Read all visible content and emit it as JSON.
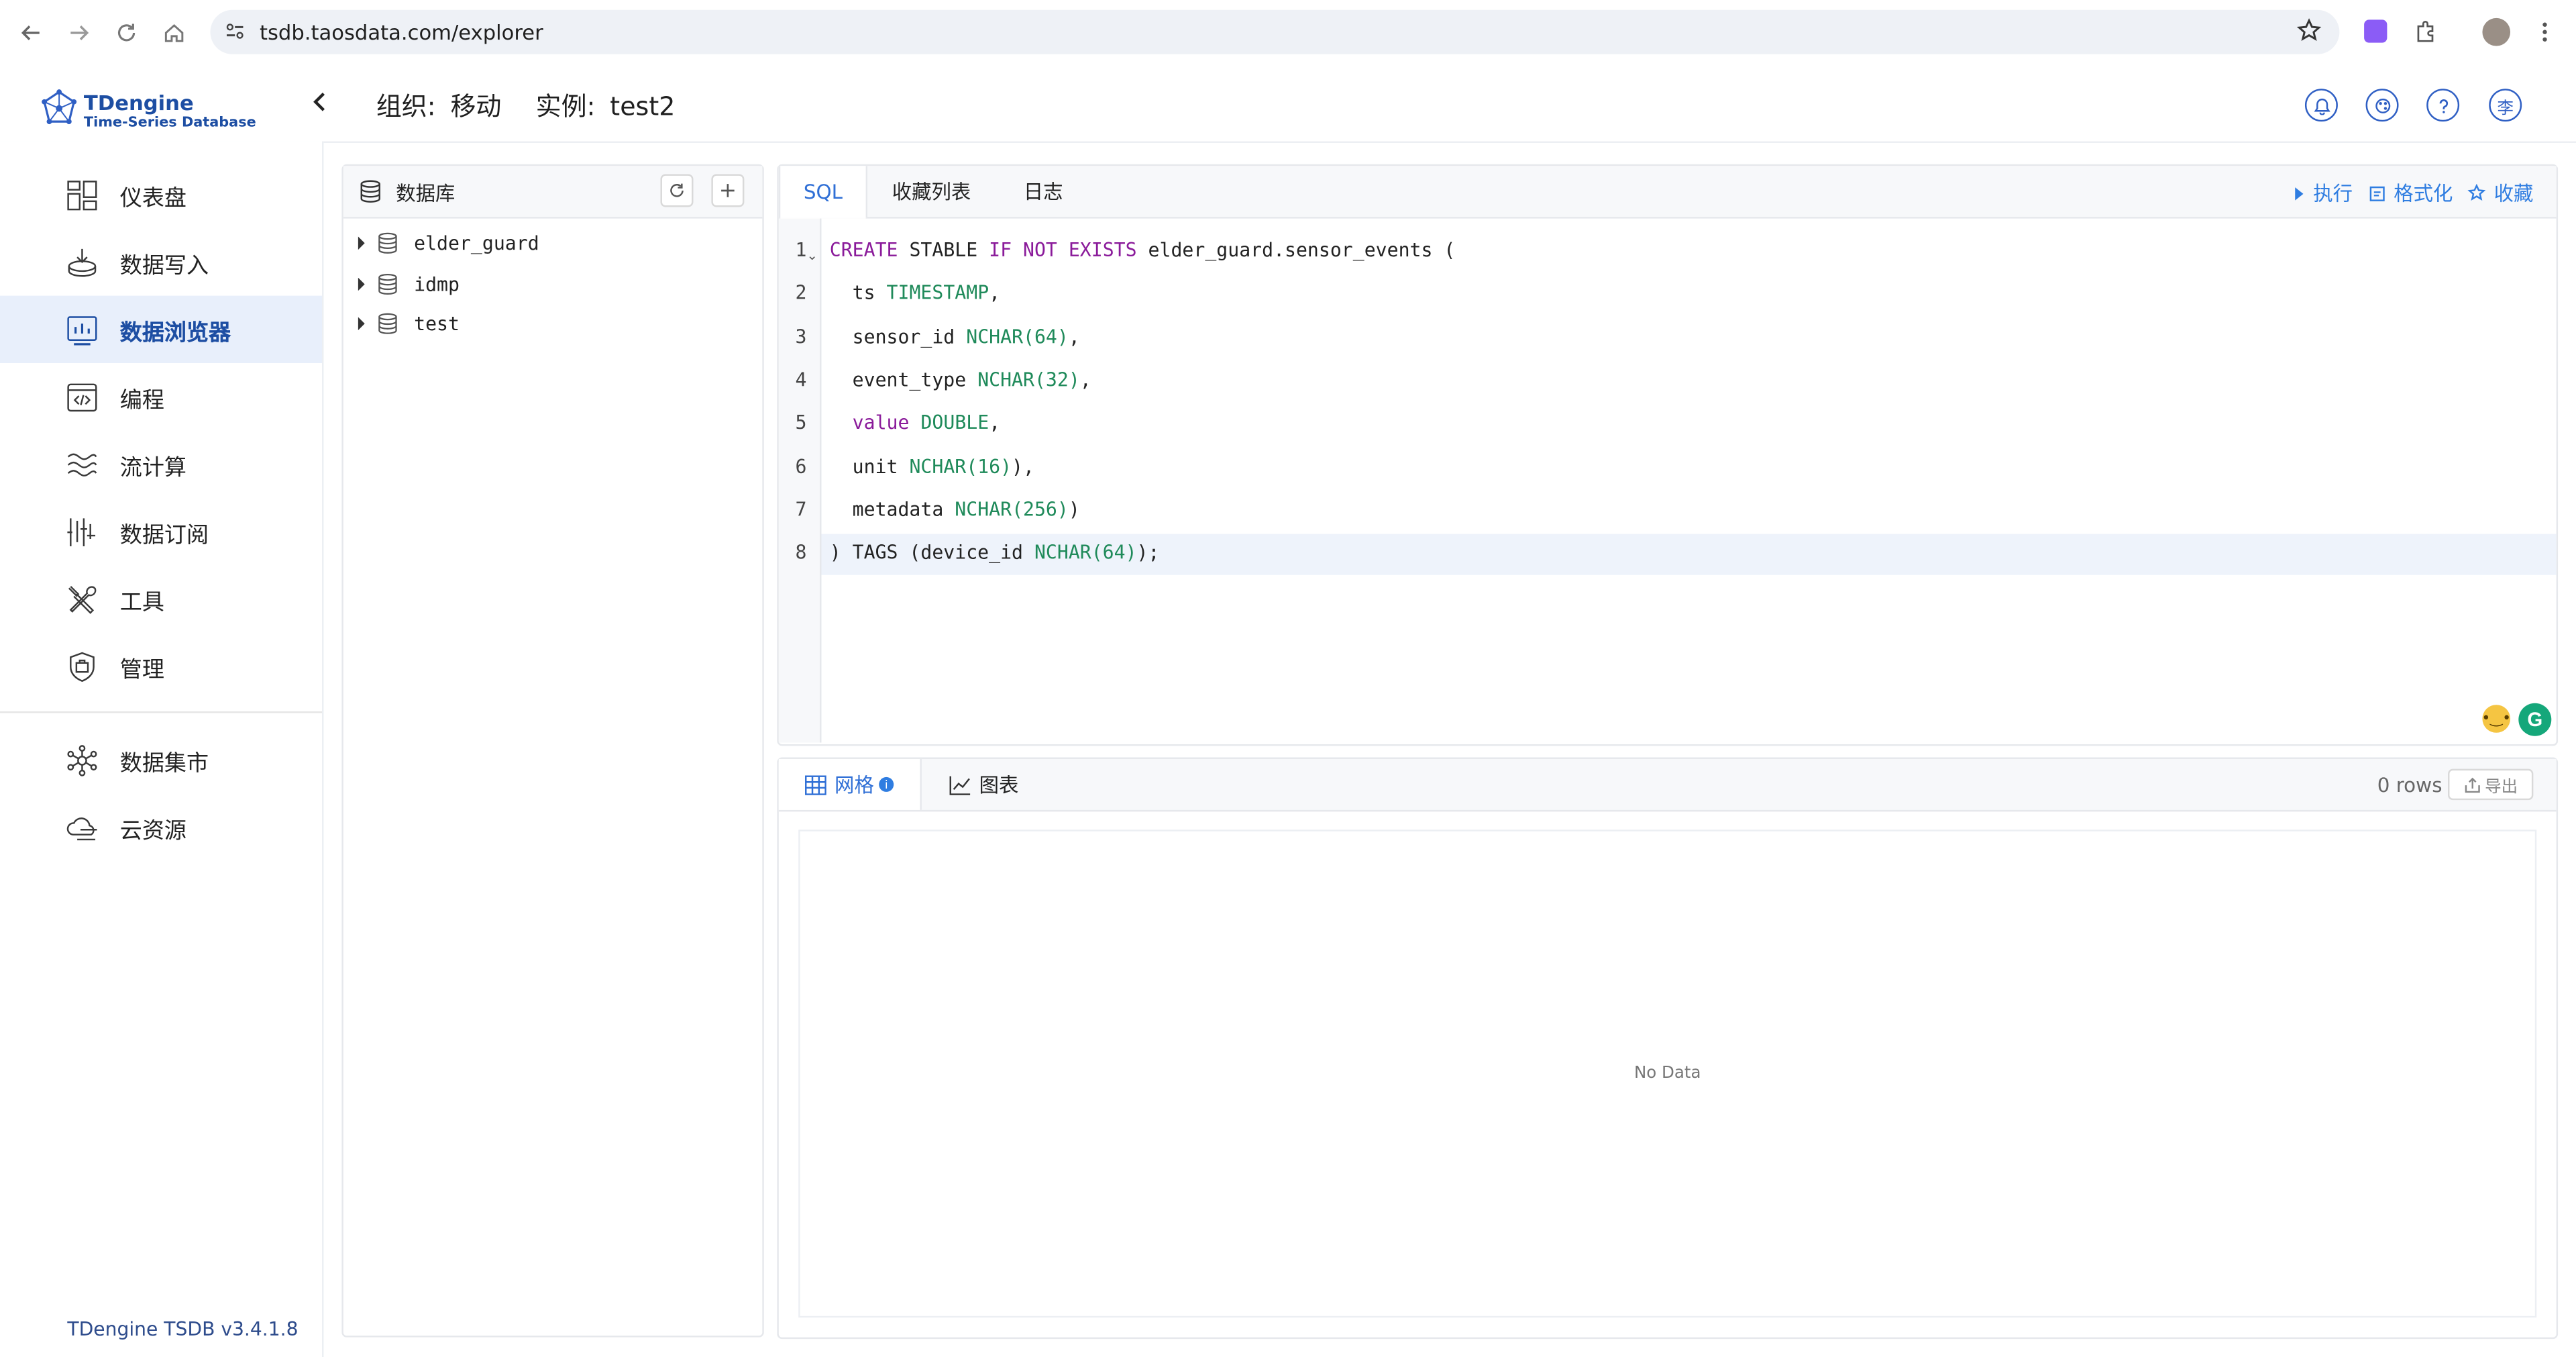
{
  "browser": {
    "url": "tsdb.taosdata.com/explorer"
  },
  "header": {
    "brand_name": "TDengine",
    "brand_sub": "Time-Series Database",
    "org_label": "组织:",
    "org_value": "移动",
    "instance_label": "实例:",
    "instance_value": "test2",
    "avatar_char": "李"
  },
  "sidebar": {
    "items": [
      {
        "label": "仪表盘",
        "icon": "dashboard-icon"
      },
      {
        "label": "数据写入",
        "icon": "data-in-icon"
      },
      {
        "label": "数据浏览器",
        "icon": "data-browser-icon",
        "active": true
      },
      {
        "label": "编程",
        "icon": "programming-icon"
      },
      {
        "label": "流计算",
        "icon": "stream-icon"
      },
      {
        "label": "数据订阅",
        "icon": "subscribe-icon"
      },
      {
        "label": "工具",
        "icon": "tools-icon"
      },
      {
        "label": "管理",
        "icon": "management-icon"
      }
    ],
    "items2": [
      {
        "label": "数据集市",
        "icon": "marketplace-icon"
      },
      {
        "label": "云资源",
        "icon": "cloud-icon"
      }
    ],
    "version": "TDengine TSDB v3.4.1.8"
  },
  "db_panel": {
    "title": "数据库",
    "databases": [
      "elder_guard",
      "idmp",
      "test"
    ]
  },
  "editor": {
    "tabs": [
      "SQL",
      "收藏列表",
      "日志"
    ],
    "actions": {
      "run": "执行",
      "format": "格式化",
      "favorite": "收藏"
    },
    "line_numbers": [
      "1",
      "2",
      "3",
      "4",
      "5",
      "6",
      "7",
      "8"
    ],
    "lines": [
      [
        {
          "t": "CREATE",
          "c": "kw"
        },
        {
          "t": " STABLE "
        },
        {
          "t": "IF NOT EXISTS",
          "c": "kw"
        },
        {
          "t": " elder_guard.sensor_events ("
        }
      ],
      [
        {
          "t": "  ts "
        },
        {
          "t": "TIMESTAMP",
          "c": "ty"
        },
        {
          "t": ","
        }
      ],
      [
        {
          "t": "  sensor_id "
        },
        {
          "t": "NCHAR(64)",
          "c": "ty"
        },
        {
          "t": ","
        }
      ],
      [
        {
          "t": "  event_type "
        },
        {
          "t": "NCHAR(32)",
          "c": "ty"
        },
        {
          "t": ","
        }
      ],
      [
        {
          "t": "  "
        },
        {
          "t": "value",
          "c": "kw"
        },
        {
          "t": " "
        },
        {
          "t": "DOUBLE",
          "c": "ty"
        },
        {
          "t": ","
        }
      ],
      [
        {
          "t": "  unit "
        },
        {
          "t": "NCHAR(16)",
          "c": "ty"
        },
        {
          "t": "),"
        }
      ],
      [
        {
          "t": "  metadata "
        },
        {
          "t": "NCHAR(256)",
          "c": "ty"
        },
        {
          "t": ")"
        }
      ],
      [
        {
          "t": ") TAGS (device_id "
        },
        {
          "t": "NCHAR(64)",
          "c": "ty"
        },
        {
          "t": ");"
        }
      ]
    ]
  },
  "results": {
    "tabs": [
      "网格",
      "图表"
    ],
    "rows": "0 rows",
    "export": "导出",
    "empty": "No Data"
  },
  "colors": {
    "accent": "#2f6fd6",
    "brand": "#1d4ea3",
    "keyword": "#8a1a9a",
    "type": "#1f8a5a"
  }
}
